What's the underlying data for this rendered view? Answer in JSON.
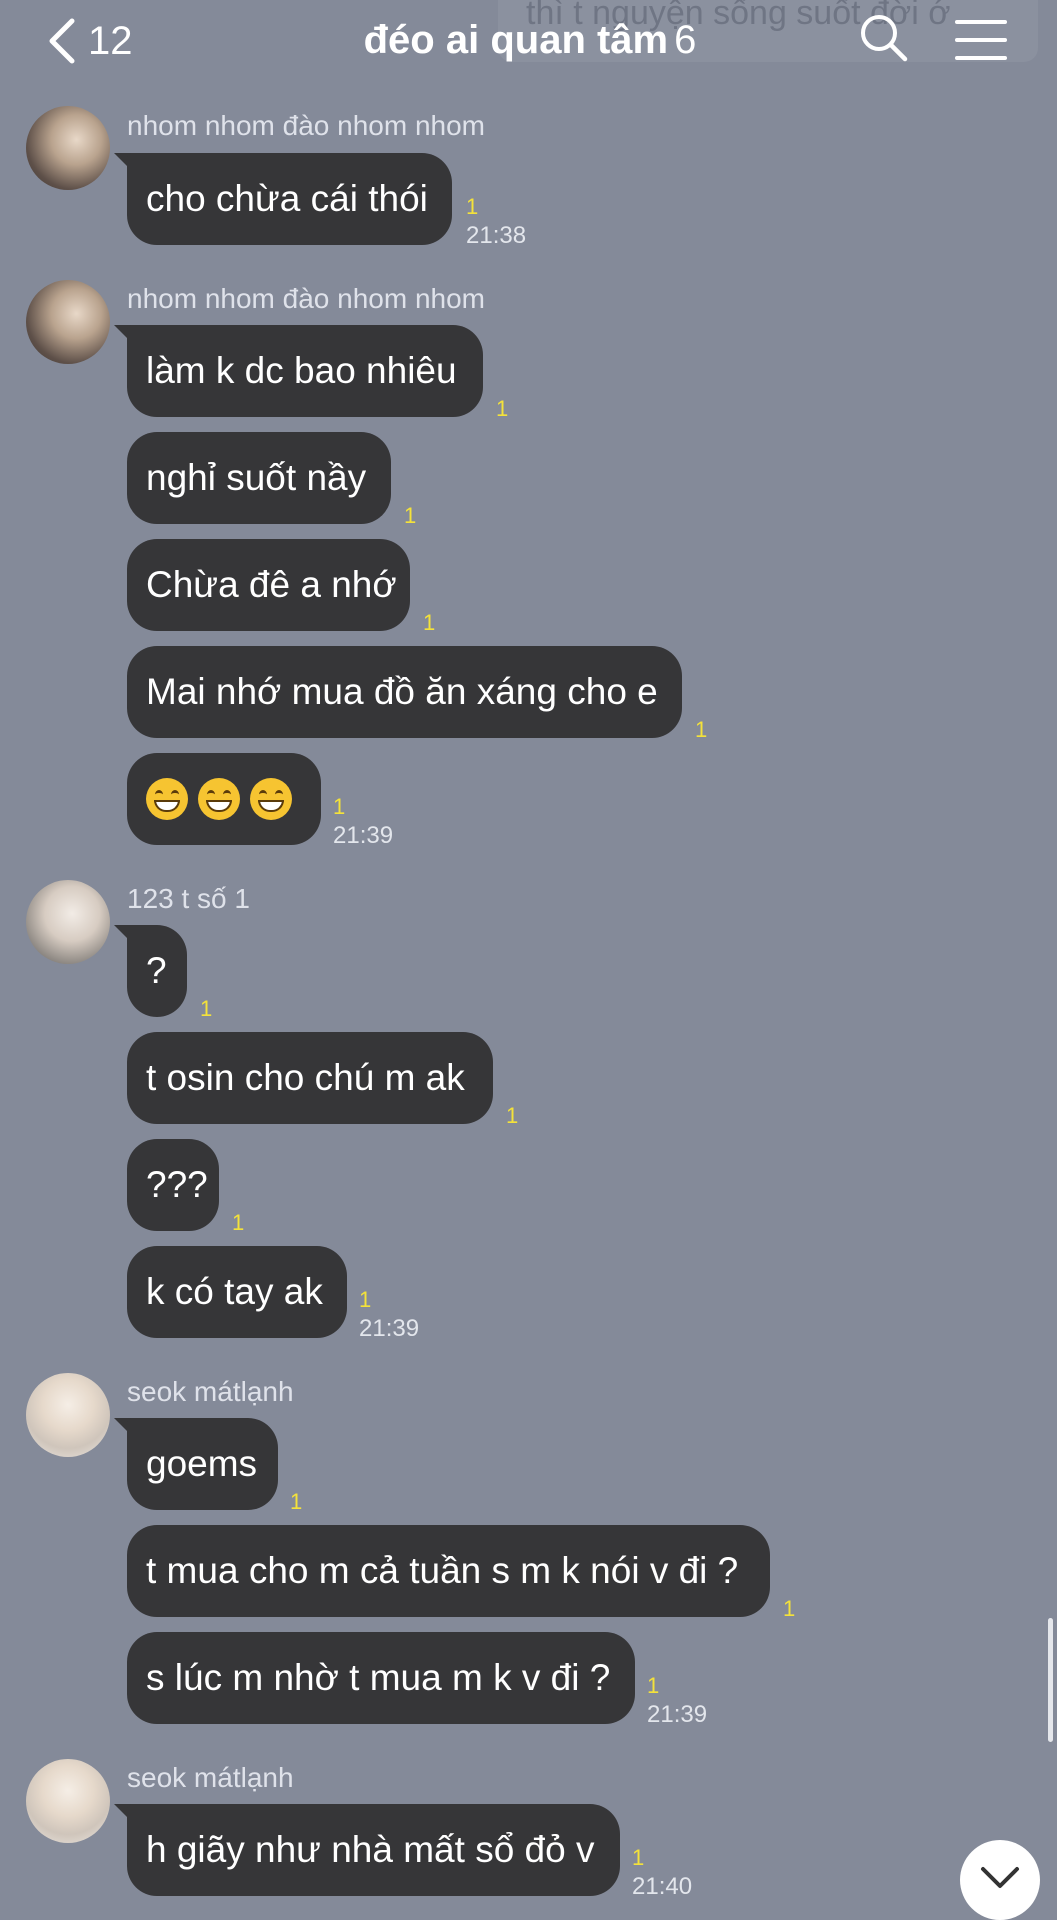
{
  "header": {
    "back_count": "12",
    "chat_title": "đéo ai quan tâm",
    "member_count": "6",
    "faded_banner_text": "thì t nguyện sống suốt đời ớ"
  },
  "messages": {
    "g1": {
      "sender": "nhom nhom đào nhom nhom",
      "m1": {
        "text": "cho chừa cái thói",
        "read": "1"
      },
      "time": "21:38"
    },
    "g2": {
      "sender": "nhom nhom đào nhom nhom",
      "m1": {
        "text": "làm k dc bao nhiêu",
        "read": "1"
      },
      "m2": {
        "text": "nghỉ suốt nầy",
        "read": "1"
      },
      "m3": {
        "text": "Chừa đê a nhớ",
        "read": "1"
      },
      "m4": {
        "text": "Mai nhớ mua đồ ăn xáng cho e",
        "read": "1"
      },
      "m5": {
        "emoji": "grinning-face x3",
        "read": "1"
      },
      "time": "21:39"
    },
    "g3": {
      "sender": "123 t số 1",
      "m1": {
        "text": "?",
        "read": "1"
      },
      "m2": {
        "text": "t osin cho chú m ak",
        "read": "1"
      },
      "m3": {
        "text": "???",
        "read": "1"
      },
      "m4": {
        "text": "k có tay ak",
        "read": "1"
      },
      "time": "21:39"
    },
    "g4": {
      "sender": "seok mátlạnh",
      "m1": {
        "text": "goems",
        "read": "1"
      },
      "m2": {
        "text": "t mua cho m cả tuần s m k nói v đi ?",
        "read": "1"
      },
      "m3": {
        "text": "s lúc m nhờ t mua m k v đi ?",
        "read": "1"
      },
      "time": "21:39"
    },
    "g5": {
      "sender": "seok mátlạnh",
      "m1": {
        "text": "h giãy như nhà mất sổ đỏ v",
        "read": "1"
      },
      "time": "21:40"
    }
  },
  "colors": {
    "background": "#848a99",
    "bubble": "#363638",
    "read_count": "#f4e23a"
  }
}
